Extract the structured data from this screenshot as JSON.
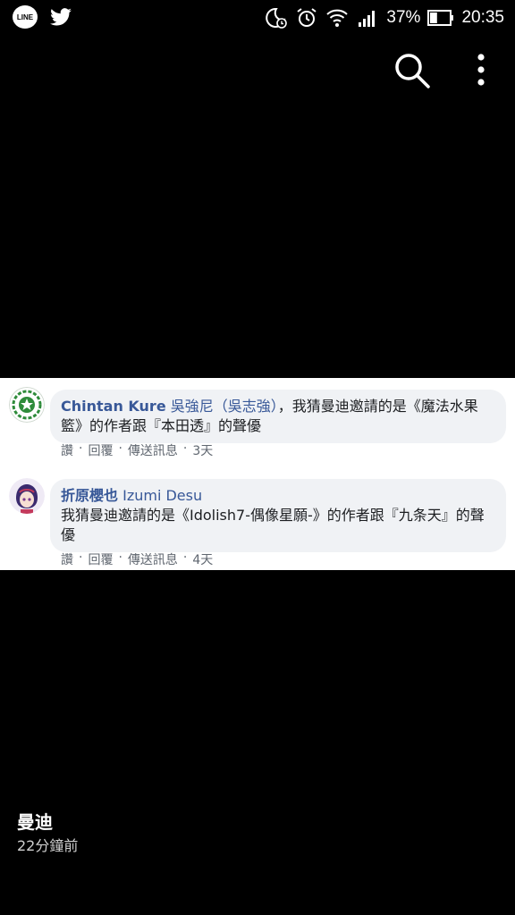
{
  "status_bar": {
    "left_icons": [
      "line-app-icon",
      "twitter-icon"
    ],
    "line_label": "LINE",
    "right_icons": [
      "do-not-disturb-icon",
      "alarm-icon",
      "wifi-icon",
      "signal-icon",
      "battery-icon"
    ],
    "battery": "37%",
    "battery_level": 0.37,
    "time": "20:35"
  },
  "toolbar": {
    "icons": [
      "search-icon",
      "more-vert-icon"
    ]
  },
  "comments": [
    {
      "author": "Chintan Kure",
      "tag": "吳強尼（吳志強）",
      "text": "，我猜曼迪邀請的是《魔法水果籃》的作者跟『本田透』的聲優",
      "actions": {
        "like": "讚",
        "reply": "回覆",
        "message": "傳送訊息",
        "time": "3天"
      }
    },
    {
      "author": "折原櫻也",
      "tag": "Izumi Desu",
      "text": "我猜曼迪邀請的是《Idolish7-偶像星願-》的作者跟『九条天』的聲優",
      "actions": {
        "like": "讚",
        "reply": "回覆",
        "message": "傳送訊息",
        "time": "4天"
      }
    }
  ],
  "separator": "·",
  "post": {
    "author": "曼迪",
    "time": "22分鐘前"
  },
  "colors": {
    "background": "#000000",
    "card": "#ffffff",
    "bubble": "#f0f2f5",
    "name": "#385898",
    "meta": "#606770"
  }
}
